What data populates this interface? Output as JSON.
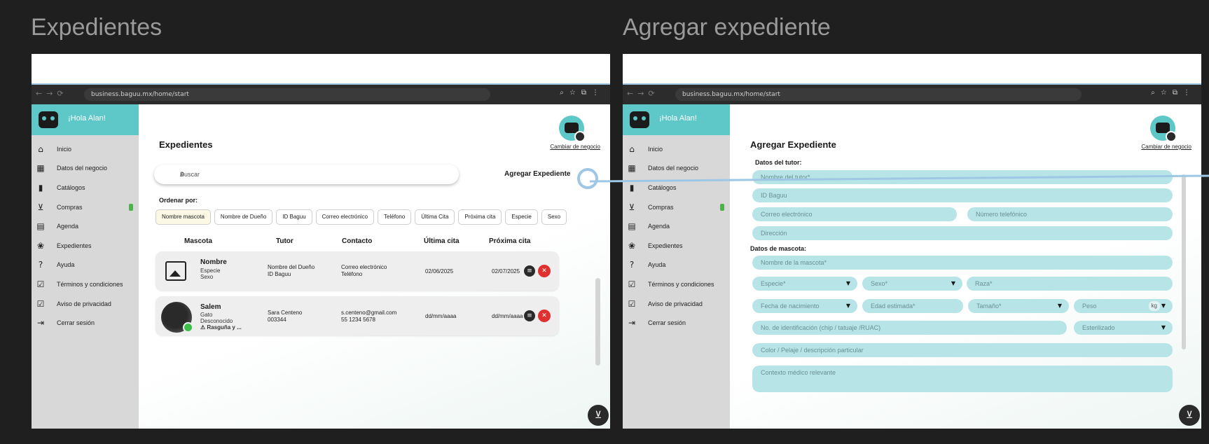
{
  "frames": {
    "left_title": "Expedientes",
    "right_title": "Agregar expediente"
  },
  "browser": {
    "url": "business.baguu.mx/home/start"
  },
  "sidebar": {
    "greeting": "¡Hola Alan!",
    "items": [
      {
        "label": "Inicio",
        "icon": "home-icon"
      },
      {
        "label": "Datos del negocio",
        "icon": "store-icon"
      },
      {
        "label": "Catálogos",
        "icon": "book-icon"
      },
      {
        "label": "Compras",
        "icon": "cart-icon"
      },
      {
        "label": "Agenda",
        "icon": "calendar-icon"
      },
      {
        "label": "Expedientes",
        "icon": "paw-icon"
      },
      {
        "label": "Ayuda",
        "icon": "help-icon"
      },
      {
        "label": "Términos y condiciones",
        "icon": "checkbox-icon"
      },
      {
        "label": "Aviso de privacidad",
        "icon": "checkbox-icon"
      },
      {
        "label": "Cerrar sesión",
        "icon": "logout-icon"
      }
    ]
  },
  "header": {
    "switch_business": "Cambiar de negocio"
  },
  "records": {
    "title": "Expedientes",
    "search_placeholder": "Buscar",
    "add_button": "Agregar Expediente",
    "sort_label": "Ordenar por:",
    "sort_options": [
      "Nombre mascota",
      "Nombre de Dueño",
      "ID Baguu",
      "Correo electrónico",
      "Teléfono",
      "Última Cita",
      "Próxima cita",
      "Especie",
      "Sexo"
    ],
    "columns": [
      "Mascota",
      "Tutor",
      "Contacto",
      "Última cita",
      "Próxima cita"
    ],
    "rows": [
      {
        "pet_name": "Nombre",
        "pet_species": "Especie",
        "pet_sex": "Sexo",
        "pet_extra": "",
        "tutor_name": "Nombre del Dueño",
        "tutor_id": "ID Baguu",
        "email": "Correo electrónico",
        "phone": "Teléfono",
        "last_visit": "02/06/2025",
        "next_visit": "02/07/2025"
      },
      {
        "pet_name": "Salem",
        "pet_species": "Gato",
        "pet_sex": "Desconocido",
        "pet_extra": "⚠ Rasguña y ...",
        "tutor_name": "Sara Centeno",
        "tutor_id": "003344",
        "email": "s.centeno@gmail.com",
        "phone": "55 1234 5678",
        "last_visit": "dd/mm/aaaa",
        "next_visit": "dd/mm/aaaa"
      }
    ]
  },
  "form": {
    "title": "Agregar Expediente",
    "tutor_section": "Datos del tutor:",
    "tutor_name": "Nombre del tutor*",
    "baguu_id": "ID Baguu",
    "email": "Correo electrónico",
    "phone": "Número telefónico",
    "address": "Dirección",
    "pet_section": "Datos de mascota:",
    "pet_name": "Nombre de la mascota*",
    "species": "Especie*",
    "sex": "Sexo*",
    "breed": "Raza*",
    "birth_date": "Fecha de nacimiento",
    "estimated_age": "Edad estimada*",
    "size": "Tamaño*",
    "weight": "Peso",
    "weight_unit": "kg",
    "id_number": "No. de identificación (chip / tatuaje /RUAC)",
    "sterilized": "Esterilizado",
    "color": "Color / Pelaje / descripción particular",
    "medical": "Contexto médico relevante"
  },
  "accent": "#5ec7c7",
  "field_color": "#b7e4e6",
  "delete_color": "#e03131"
}
